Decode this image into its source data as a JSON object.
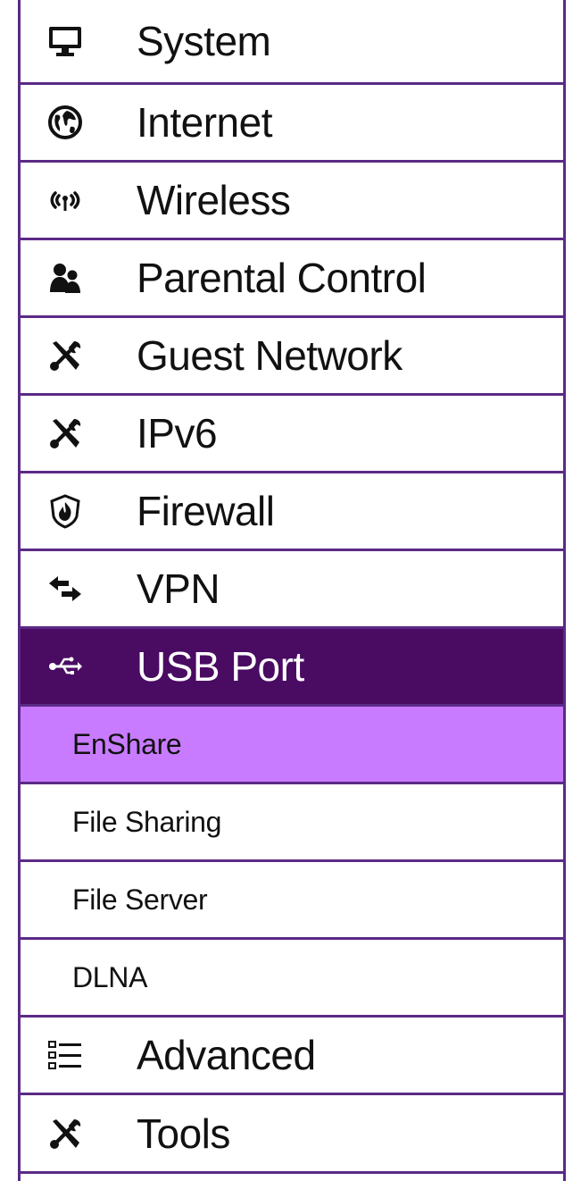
{
  "menu": {
    "items": [
      {
        "label": "System",
        "icon": "monitor-icon"
      },
      {
        "label": "Internet",
        "icon": "globe-icon"
      },
      {
        "label": "Wireless",
        "icon": "wireless-signal-icon"
      },
      {
        "label": "Parental Control",
        "icon": "users-icon"
      },
      {
        "label": "Guest Network",
        "icon": "tools-icon"
      },
      {
        "label": "IPv6",
        "icon": "tools-icon"
      },
      {
        "label": "Firewall",
        "icon": "shield-flame-icon"
      },
      {
        "label": "VPN",
        "icon": "arrows-exchange-icon"
      },
      {
        "label": "USB Port",
        "icon": "usb-icon",
        "active": true
      }
    ],
    "usb_subitems": [
      {
        "label": "EnShare",
        "selected": true
      },
      {
        "label": "File Sharing"
      },
      {
        "label": "File Server"
      },
      {
        "label": "DLNA"
      }
    ],
    "trailing_items": [
      {
        "label": "Advanced",
        "icon": "list-icon"
      },
      {
        "label": "Tools",
        "icon": "tools-icon"
      }
    ]
  },
  "colors": {
    "border": "#5b2a86",
    "active_bg": "#4a0b63",
    "selected_sub_bg": "#c97bff",
    "text": "#111111"
  }
}
